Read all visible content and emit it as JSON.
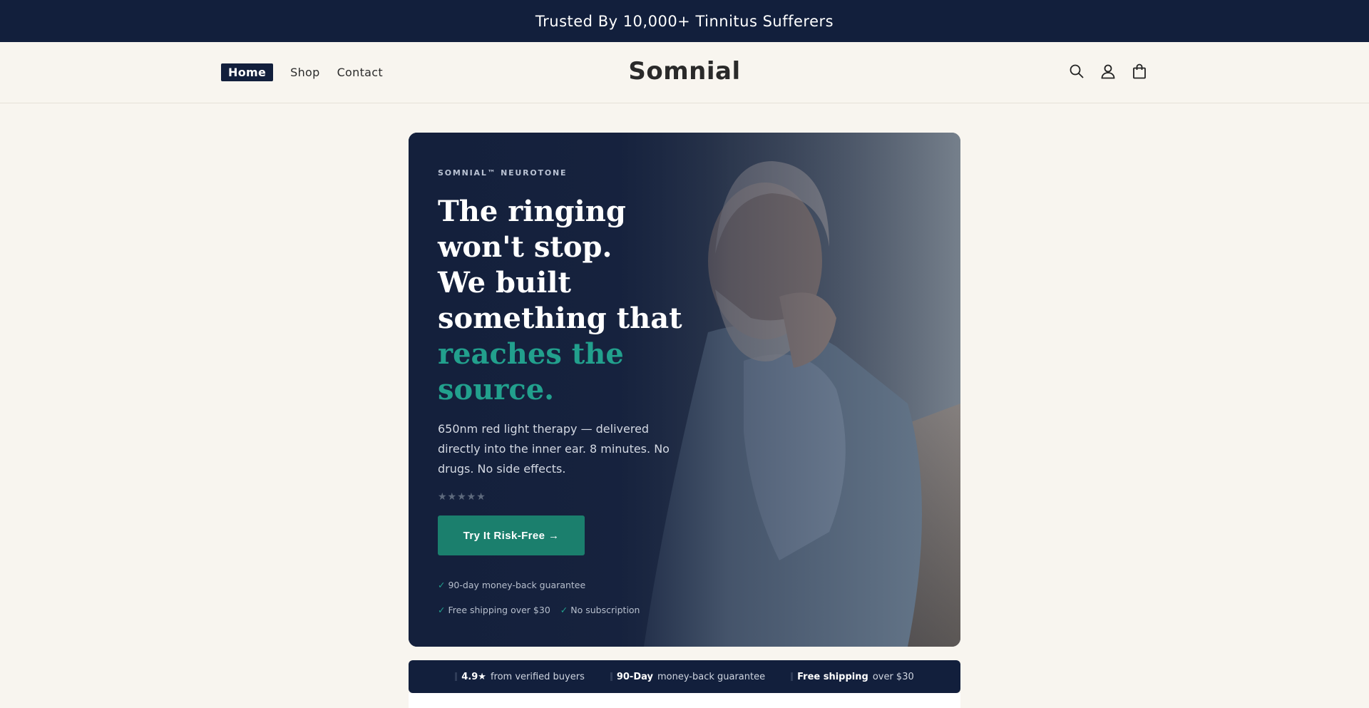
{
  "announcement": {
    "text": "Trusted By 10,000+ Tinnitus Sufferers"
  },
  "header": {
    "nav": [
      {
        "label": "Home",
        "active": true
      },
      {
        "label": "Shop",
        "active": false
      },
      {
        "label": "Contact",
        "active": false
      }
    ],
    "logo": "Somnial",
    "icons": [
      "search-icon",
      "account-icon",
      "cart-icon"
    ]
  },
  "hero": {
    "eyebrow": "SOMNIAL™ NEUROTONE",
    "headline_lines": [
      "The ringing",
      "won't stop.",
      "We built",
      "something that"
    ],
    "headline_accent_lines": [
      "reaches the",
      "source."
    ],
    "subtext": "650nm red light therapy — delivered directly into the inner ear. 8 minutes. No drugs. No side effects.",
    "stars": "★★★★★",
    "cta_label": "Try It Risk-Free →",
    "checks": [
      "90-day money-back guarantee",
      "Free shipping over $30",
      "No subscription"
    ]
  },
  "trust_bar": [
    {
      "bold": "4.9★",
      "text": "from verified buyers"
    },
    {
      "bold": "90-Day",
      "text": "money-back guarantee"
    },
    {
      "bold": "Free shipping",
      "text": "over $30"
    }
  ],
  "colors": {
    "navy": "#121f3c",
    "accent": "#22a08d",
    "cta": "#1b7f6d",
    "background": "#f8f5ef"
  }
}
